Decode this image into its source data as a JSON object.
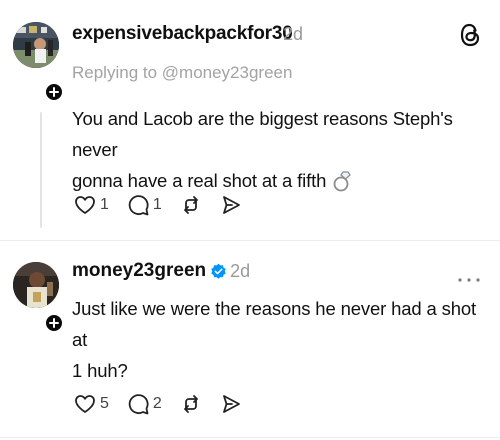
{
  "post1": {
    "username": "expensivebackpackfor30",
    "time": "2d",
    "reply_to": "Replying to @money23green",
    "text_line1": "You and Lacob are the biggest reasons Steph's never",
    "text_line2": "gonna have a real shot at a fifth",
    "emoji": "ring-icon",
    "likes": "1",
    "replies": "1"
  },
  "post2": {
    "username": "money23green",
    "time": "2d",
    "text_line1": "Just like we were the reasons he never had a shot at",
    "text_line2": "1 huh?",
    "likes": "5",
    "replies": "2",
    "verified": true
  },
  "colors": {
    "verified_blue": "#0095f6",
    "muted": "#9a9a9a",
    "text": "#111111"
  }
}
